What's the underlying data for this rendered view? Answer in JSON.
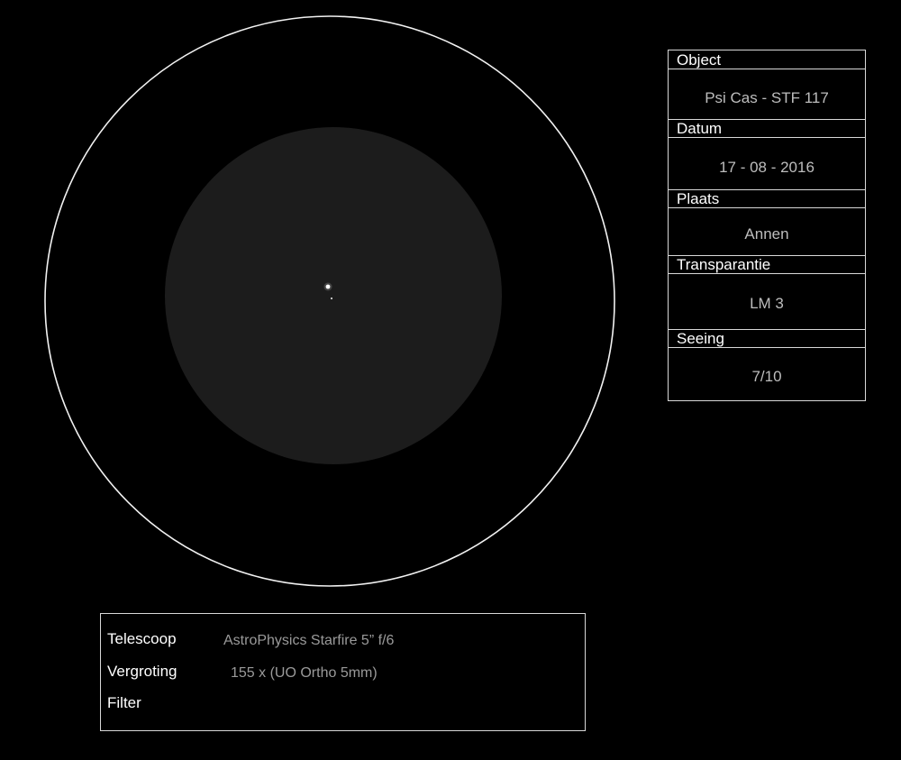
{
  "info": {
    "object_label": "Object",
    "object_value": "Psi Cas - STF 117",
    "date_label": "Datum",
    "date_value": "17 - 08 - 2016",
    "place_label": "Plaats",
    "place_value": "Annen",
    "transparency_label": "Transparantie",
    "transparency_value": "LM 3",
    "seeing_label": "Seeing",
    "seeing_value": "7/10"
  },
  "equipment": {
    "telescope_label": "Telescoop",
    "telescope_value": "AstroPhysics Starfire 5” f/6",
    "magnification_label": "Vergroting",
    "magnification_value": "155 x (UO Ortho 5mm)",
    "filter_label": "Filter",
    "filter_value": ""
  },
  "colors": {
    "background": "#000000",
    "frame_line": "#ffffff",
    "field_of_view": "#1c1c1c",
    "star": "#ffffff"
  }
}
